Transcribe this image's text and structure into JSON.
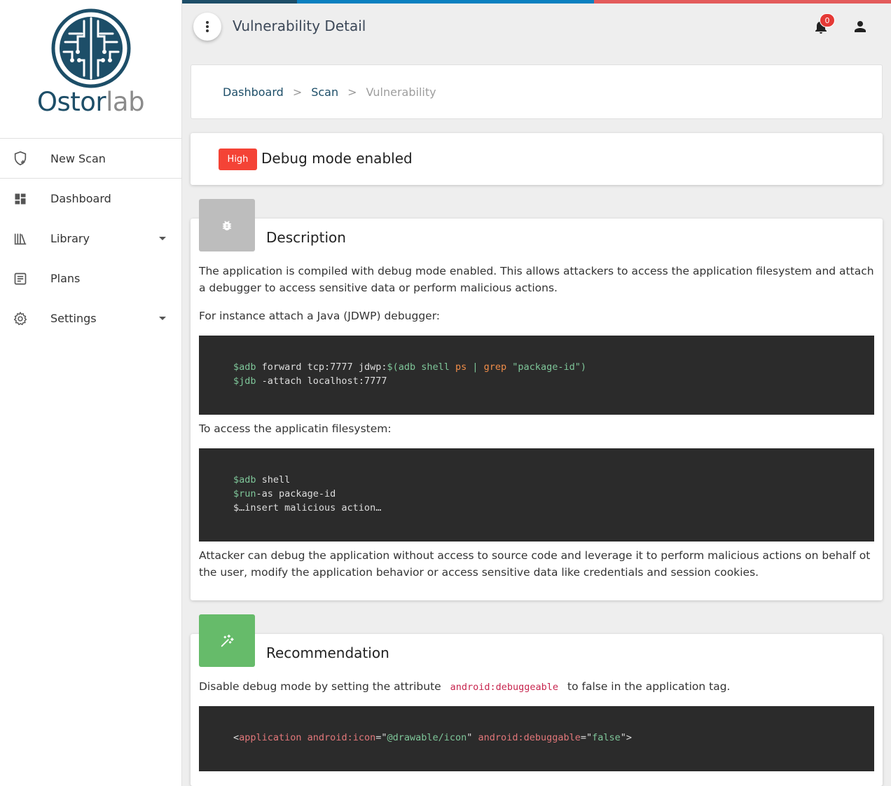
{
  "app": {
    "logo_text_primary": "Ostor",
    "logo_text_secondary": "lab",
    "page_title": "Vulnerability Detail",
    "notification_count": "0"
  },
  "sidebar": {
    "items": [
      {
        "label": "New Scan",
        "icon": "shield-plus-icon"
      },
      {
        "label": "Dashboard",
        "icon": "dashboard-icon"
      },
      {
        "label": "Library",
        "icon": "library-icon"
      },
      {
        "label": "Plans",
        "icon": "plans-icon"
      },
      {
        "label": "Settings",
        "icon": "gear-icon"
      }
    ]
  },
  "breadcrumb": {
    "items": [
      "Dashboard",
      "Scan"
    ],
    "separator": ">",
    "current": "Vulnerability"
  },
  "vulnerability": {
    "severity": "High",
    "title": "Debug mode enabled"
  },
  "description": {
    "title": "Description",
    "para1": "The application is compiled with debug mode enabled. This allows attackers to access the application filesystem and attach a debugger to access sensitive data or perform malicious actions.",
    "para2": "For instance attach a Java (JDWP) debugger:",
    "code1_line1": {
      "var1": "$adb",
      "text1": " forward tcp:7777 jdwp:",
      "sub_open": "$(adb shell ",
      "cmd_ps": "ps",
      "pipe": " | ",
      "cmd_grep": "grep",
      "str": " \"package-id\"",
      "sub_close": ")"
    },
    "code1_line2": {
      "var": "$jdb",
      "text": " -attach localhost:7777"
    },
    "para3": "To access the applicatin filesystem:",
    "code2_line1": {
      "var": "$adb",
      "text": " shell"
    },
    "code2_line2": {
      "var": "$run",
      "text": "-as package-id"
    },
    "code2_line3": {
      "text": "$…insert malicious action…"
    },
    "para4": "Attacker can debug the application without access to source code and leverage it to perform malicious actions on behalf ot the user, modify the application behavior or access sensitive data like credentials and session cookies."
  },
  "recommendation": {
    "title": "Recommendation",
    "text_before": "Disable debug mode by setting the attribute",
    "inline_code": "android:debuggeable",
    "text_after": "to false in the application tag.",
    "code": {
      "lt": "<",
      "tag": "application",
      "attr1": " android:icon",
      "eq1": "=\"",
      "val1": "@drawable/icon",
      "q1": "\"",
      "attr2": " android:debuggable",
      "eq2": "=\"",
      "val2": "false",
      "end": "\">"
    }
  },
  "colors": {
    "brand": "#1d4e68",
    "severity_high": "#f44336",
    "description_icon_bg": "#bdbdbd",
    "recommendation_icon_bg": "#66bb6a",
    "code_bg": "#2b2b2b",
    "top_bar_segments": [
      "#1d4e68",
      "#0a80c0",
      "#e35b5b"
    ]
  }
}
